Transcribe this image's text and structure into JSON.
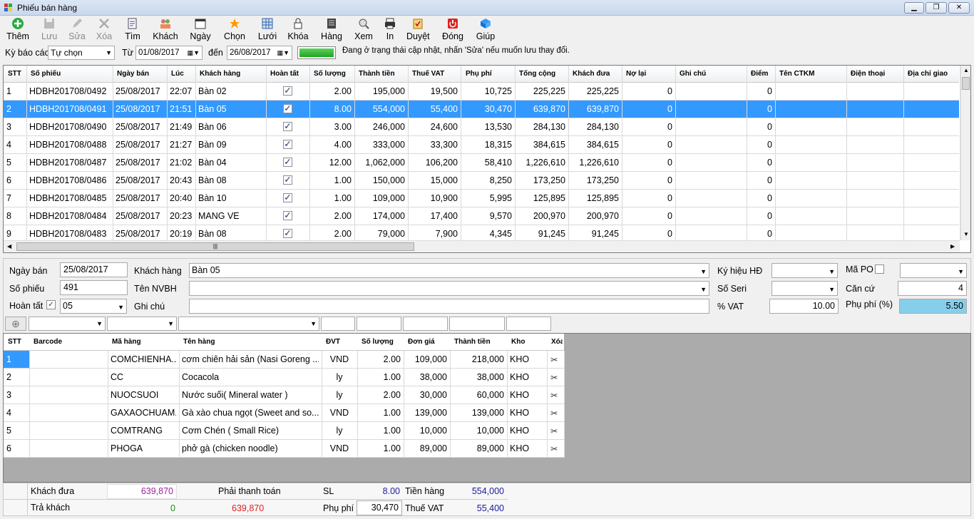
{
  "window": {
    "title": "Phiếu bán hàng"
  },
  "toolbar": [
    {
      "label": "Thêm",
      "icon": "add-icon",
      "enabled": true
    },
    {
      "label": "Lưu",
      "icon": "save-icon",
      "enabled": false
    },
    {
      "label": "Sửa",
      "icon": "edit-icon",
      "enabled": false
    },
    {
      "label": "Xóa",
      "icon": "delete-icon",
      "enabled": false
    },
    {
      "label": "Tìm",
      "icon": "search-icon",
      "enabled": true
    },
    {
      "label": "Khách",
      "icon": "customer-icon",
      "enabled": true
    },
    {
      "label": "Ngày",
      "icon": "calendar-icon",
      "enabled": true
    },
    {
      "label": "Chọn",
      "icon": "select-icon",
      "enabled": true
    },
    {
      "label": "Lưới",
      "icon": "grid-icon",
      "enabled": true
    },
    {
      "label": "Khóa",
      "icon": "lock-icon",
      "enabled": true
    },
    {
      "label": "Hàng",
      "icon": "goods-icon",
      "enabled": true
    },
    {
      "label": "Xem",
      "icon": "view-icon",
      "enabled": true
    },
    {
      "label": "In",
      "icon": "print-icon",
      "enabled": true
    },
    {
      "label": "Duyệt",
      "icon": "approve-icon",
      "enabled": true
    },
    {
      "label": "Đóng",
      "icon": "power-icon",
      "enabled": true
    },
    {
      "label": "Giúp",
      "icon": "help-icon",
      "enabled": true
    }
  ],
  "filter": {
    "period_label": "Kỳ báo cáo",
    "period_value": "Tự chọn",
    "from_label": "Từ",
    "from_date": "01/08/2017",
    "to_label": "đến",
    "to_date": "26/08/2017",
    "status_msg": "Đang ở trạng thái cập nhật, nhấn 'Sửa' nếu muốn lưu thay đổi.",
    "status_color": "#e00000"
  },
  "invoice_grid": {
    "headers": [
      "STT",
      "Số phiếu",
      "Ngày bán",
      "Lúc",
      "Khách hàng",
      "Hoàn tất",
      "Số lượng",
      "Thành tiền",
      "Thuế VAT",
      "Phụ phí",
      "Tổng cộng",
      "Khách đưa",
      "Nợ lại",
      "Ghi chú",
      "Điểm",
      "Tên CTKM",
      "Điện thoại",
      "Địa chỉ giao"
    ],
    "rows": [
      [
        "1",
        "HDBH201708/0492",
        "25/08/2017",
        "22:07",
        "Bàn 02",
        "✓",
        "2.00",
        "195,000",
        "19,500",
        "10,725",
        "225,225",
        "225,225",
        "0",
        "",
        "0",
        "",
        "",
        ""
      ],
      [
        "2",
        "HDBH201708/0491",
        "25/08/2017",
        "21:51",
        "Bàn 05",
        "✓",
        "8.00",
        "554,000",
        "55,400",
        "30,470",
        "639,870",
        "639,870",
        "0",
        "",
        "0",
        "",
        "",
        ""
      ],
      [
        "3",
        "HDBH201708/0490",
        "25/08/2017",
        "21:49",
        "Bàn 06",
        "✓",
        "3.00",
        "246,000",
        "24,600",
        "13,530",
        "284,130",
        "284,130",
        "0",
        "",
        "0",
        "",
        "",
        ""
      ],
      [
        "4",
        "HDBH201708/0488",
        "25/08/2017",
        "21:27",
        "Bàn 09",
        "✓",
        "4.00",
        "333,000",
        "33,300",
        "18,315",
        "384,615",
        "384,615",
        "0",
        "",
        "0",
        "",
        "",
        ""
      ],
      [
        "5",
        "HDBH201708/0487",
        "25/08/2017",
        "21:02",
        "Bàn 04",
        "✓",
        "12.00",
        "1,062,000",
        "106,200",
        "58,410",
        "1,226,610",
        "1,226,610",
        "0",
        "",
        "0",
        "",
        "",
        ""
      ],
      [
        "6",
        "HDBH201708/0486",
        "25/08/2017",
        "20:43",
        "Bàn 08",
        "✓",
        "1.00",
        "150,000",
        "15,000",
        "8,250",
        "173,250",
        "173,250",
        "0",
        "",
        "0",
        "",
        "",
        ""
      ],
      [
        "7",
        "HDBH201708/0485",
        "25/08/2017",
        "20:40",
        "Bàn 10",
        "✓",
        "1.00",
        "109,000",
        "10,900",
        "5,995",
        "125,895",
        "125,895",
        "0",
        "",
        "0",
        "",
        "",
        ""
      ],
      [
        "8",
        "HDBH201708/0484",
        "25/08/2017",
        "20:23",
        "MANG VE",
        "✓",
        "2.00",
        "174,000",
        "17,400",
        "9,570",
        "200,970",
        "200,970",
        "0",
        "",
        "0",
        "",
        "",
        ""
      ],
      [
        "9",
        "HDBH201708/0483",
        "25/08/2017",
        "20:19",
        "Bàn 08",
        "✓",
        "2.00",
        "79,000",
        "7,900",
        "4,345",
        "91,245",
        "91,245",
        "0",
        "",
        "0",
        "",
        "",
        ""
      ]
    ],
    "selected_row": 1
  },
  "form": {
    "sale_date_label": "Ngày bán",
    "sale_date": "25/08/2017",
    "customer_label": "Khách hàng",
    "customer": "Bàn 05",
    "invoice_sign_label": "Ký hiệu HĐ",
    "po_label": "Mã PO",
    "receipt_no_label": "Số phiếu",
    "receipt_no": "491",
    "staff_label": "Tên NVBH",
    "serial_label": "Số Seri",
    "basis_label": "Căn cứ",
    "basis": "4",
    "done_label": "Hoàn tất",
    "done_code": "05",
    "note_label": "Ghi chú",
    "vat_label": "% VAT",
    "vat": "10.00",
    "fee_label": "Phụ phí (%)",
    "fee": "5.50"
  },
  "detail_grid": {
    "headers": [
      "STT",
      "Barcode",
      "Mã hàng",
      "Tên hàng",
      "ĐVT",
      "Số lượng",
      "Đơn giá",
      "Thành tiền",
      "Kho",
      "Xóa"
    ],
    "rows": [
      [
        "1",
        "",
        "COMCHIENHA...",
        "cơm chiên hải sản (Nasi Goreng ...",
        "VND",
        "2.00",
        "109,000",
        "218,000",
        "KHO"
      ],
      [
        "2",
        "",
        "CC",
        "Cocacola",
        "ly",
        "1.00",
        "38,000",
        "38,000",
        "KHO"
      ],
      [
        "3",
        "",
        "NUOCSUOI",
        "Nước suối( Mineral water )",
        "ly",
        "2.00",
        "30,000",
        "60,000",
        "KHO"
      ],
      [
        "4",
        "",
        "GAXAOCHUAM...",
        "Gà xào chua ngọt (Sweet and so...",
        "VND",
        "1.00",
        "139,000",
        "139,000",
        "KHO"
      ],
      [
        "5",
        "",
        "COMTRANG",
        "Cơm Chén ( Small Rice)",
        "ly",
        "1.00",
        "10,000",
        "10,000",
        "KHO"
      ],
      [
        "6",
        "",
        "PHOGA",
        "phở gà (chicken noodle)",
        "VND",
        "1.00",
        "89,000",
        "89,000",
        "KHO"
      ]
    ]
  },
  "footer": {
    "customer_paid_label": "Khách đưa",
    "customer_paid": "639,870",
    "change_label": "Trả khách",
    "change": "0",
    "payable_label": "Phải thanh toán",
    "payable": "639,870",
    "qty_label": "SL",
    "qty": "8.00",
    "fee_label": "Phụ phí",
    "fee": "30,470",
    "goods_label": "Tiền hàng",
    "goods": "554,000",
    "vat_label": "Thuế VAT",
    "vat": "55,400"
  }
}
